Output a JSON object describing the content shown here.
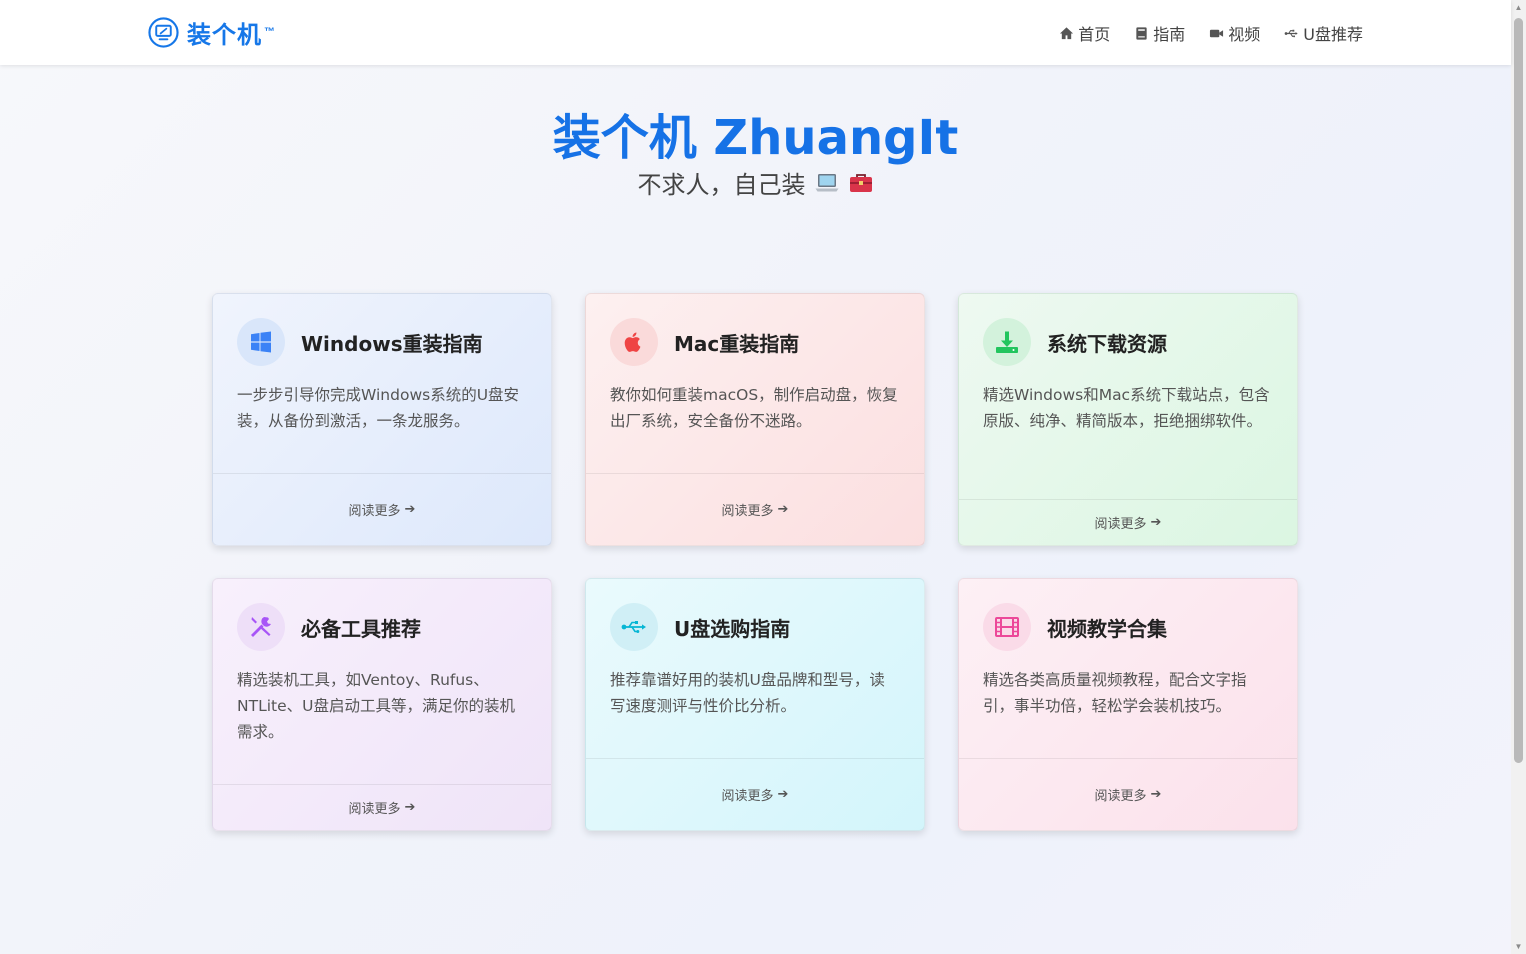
{
  "brand": {
    "name": "装个机",
    "tm": "™",
    "icon": "screwdriver-monitor-logo"
  },
  "nav": [
    {
      "label": "首页",
      "icon": "home-icon"
    },
    {
      "label": "指南",
      "icon": "book-icon"
    },
    {
      "label": "视频",
      "icon": "video-icon"
    },
    {
      "label": "U盘推荐",
      "icon": "usb-icon"
    }
  ],
  "hero": {
    "title": "装个机 ZhuangIt",
    "subtitle": "不求人，自己装",
    "subtitle_icons": [
      "laptop-emoji",
      "toolbox-emoji"
    ]
  },
  "cards": [
    {
      "title": "Windows重装指南",
      "icon": "windows-icon",
      "desc": "一步步引导你完成Windows系统的U盘安装，从备份到激活，一条龙服务。",
      "link": "阅读更多",
      "colors": {
        "bg_top": "#eef3fd",
        "bg_bottom": "#dde9fb",
        "icon_bg": "#dbe7fa",
        "icon": "#3b82f6"
      }
    },
    {
      "title": "Mac重装指南",
      "icon": "apple-icon",
      "desc": "教你如何重装macOS，制作启动盘，恢复出厂系统，安全备份不迷路。",
      "link": "阅读更多",
      "colors": {
        "bg_top": "#fdeeee",
        "bg_bottom": "#fbdfe0",
        "icon_bg": "#fbdcdc",
        "icon": "#ef4444"
      }
    },
    {
      "title": "系统下载资源",
      "icon": "download-icon",
      "desc": "精选Windows和Mac系统下载站点，包含原版、纯净、精简版本，拒绝捆绑软件。",
      "link": "阅读更多",
      "colors": {
        "bg_top": "#eaf8ee",
        "bg_bottom": "#dcf7e3",
        "icon_bg": "#d5f3de",
        "icon": "#22c55e"
      }
    },
    {
      "title": "必备工具推荐",
      "icon": "tools-icon",
      "desc": "精选装机工具，如Ventoy、Rufus、NTLite、U盘启动工具等，满足你的装机需求。",
      "link": "阅读更多",
      "colors": {
        "bg_top": "#f6eefb",
        "bg_bottom": "#f0e5f8",
        "icon_bg": "#efe0f8",
        "icon": "#a855f7"
      }
    },
    {
      "title": "U盘选购指南",
      "icon": "usb-icon",
      "desc": "推荐靠谱好用的装机U盘品牌和型号，读写速度测评与性价比分析。",
      "link": "阅读更多",
      "colors": {
        "bg_top": "#e6f9fc",
        "bg_bottom": "#d8f6fb",
        "icon_bg": "#d3f1f7",
        "icon": "#06b6d4"
      }
    },
    {
      "title": "视频教学合集",
      "icon": "film-icon",
      "desc": "精选各类高质量视频教程，配合文字指引，事半功倍，轻松学会装机技巧。",
      "link": "阅读更多",
      "colors": {
        "bg_top": "#fdeef4",
        "bg_bottom": "#fbe2ec",
        "icon_bg": "#fbdde9",
        "icon": "#ec4899"
      }
    }
  ]
}
